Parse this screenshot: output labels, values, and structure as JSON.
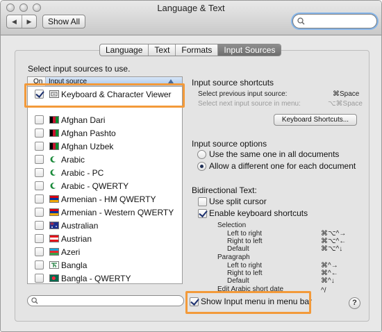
{
  "window": {
    "title": "Language & Text"
  },
  "toolbar": {
    "show_all_label": "Show All",
    "search_value": ""
  },
  "tabs": [
    {
      "label": "Language",
      "active": false
    },
    {
      "label": "Text",
      "active": false
    },
    {
      "label": "Formats",
      "active": false
    },
    {
      "label": "Input Sources",
      "active": true
    }
  ],
  "list": {
    "heading": "Select input sources to use.",
    "col_on": "On",
    "col_source": "Input source",
    "items": [
      {
        "label": "Keyboard & Character Viewer",
        "checked": true,
        "icon": "keyboard-viewer-icon"
      },
      {
        "label": "Afghan Dari",
        "checked": false,
        "icon": "afghanistan-flag-icon"
      },
      {
        "label": "Afghan Pashto",
        "checked": false,
        "icon": "afghanistan-flag-icon"
      },
      {
        "label": "Afghan Uzbek",
        "checked": false,
        "icon": "afghanistan-flag-icon"
      },
      {
        "label": "Arabic",
        "checked": false,
        "icon": "arabic-crescent-icon"
      },
      {
        "label": "Arabic - PC",
        "checked": false,
        "icon": "arabic-crescent-icon"
      },
      {
        "label": "Arabic - QWERTY",
        "checked": false,
        "icon": "arabic-crescent-icon"
      },
      {
        "label": "Armenian - HM QWERTY",
        "checked": false,
        "icon": "armenia-flag-icon"
      },
      {
        "label": "Armenian - Western QWERTY",
        "checked": false,
        "icon": "armenia-flag-icon"
      },
      {
        "label": "Australian",
        "checked": false,
        "icon": "australia-flag-icon"
      },
      {
        "label": "Austrian",
        "checked": false,
        "icon": "austria-flag-icon"
      },
      {
        "label": "Azeri",
        "checked": false,
        "icon": "azerbaijan-flag-icon"
      },
      {
        "label": "Bangla",
        "checked": false,
        "icon": "bangla-icon"
      },
      {
        "label": "Bangla - QWERTY",
        "checked": false,
        "icon": "bangladesh-flag-icon"
      }
    ],
    "filter_value": ""
  },
  "shortcuts": {
    "title": "Input source shortcuts",
    "prev_label": "Select previous input source:",
    "prev_key": "⌘Space",
    "next_label": "Select next input source in menu:",
    "next_key": "⌥⌘Space",
    "button_label": "Keyboard Shortcuts..."
  },
  "options": {
    "title": "Input source options",
    "radio_same": "Use the same one in all documents",
    "radio_diff": "Allow a different one for each document",
    "selected": "diff"
  },
  "bidi": {
    "title": "Bidirectional Text:",
    "split_cursor": "Use split cursor",
    "split_cursor_checked": false,
    "enable_shortcuts": "Enable keyboard shortcuts",
    "enable_shortcuts_checked": true,
    "selection_title": "Selection",
    "selection_items": [
      {
        "label": "Left to right",
        "key": "⌘⌥^→"
      },
      {
        "label": "Right to left",
        "key": "⌘⌥^←"
      },
      {
        "label": "Default",
        "key": "⌘⌥^↓"
      }
    ],
    "paragraph_title": "Paragraph",
    "paragraph_items": [
      {
        "label": "Left to right",
        "key": "⌘^→"
      },
      {
        "label": "Right to left",
        "key": "⌘^←"
      },
      {
        "label": "Default",
        "key": "⌘^↓"
      }
    ],
    "edit_arabic": "Edit Arabic short date",
    "edit_arabic_key": "^/"
  },
  "menu_bar": {
    "label": "Show Input menu in menu bar",
    "checked": true
  },
  "help": {
    "label": "?"
  },
  "colors": {
    "highlight": "#f39a3a",
    "accent": "#1b2f6e",
    "selected_header": "#a9c6ea"
  }
}
